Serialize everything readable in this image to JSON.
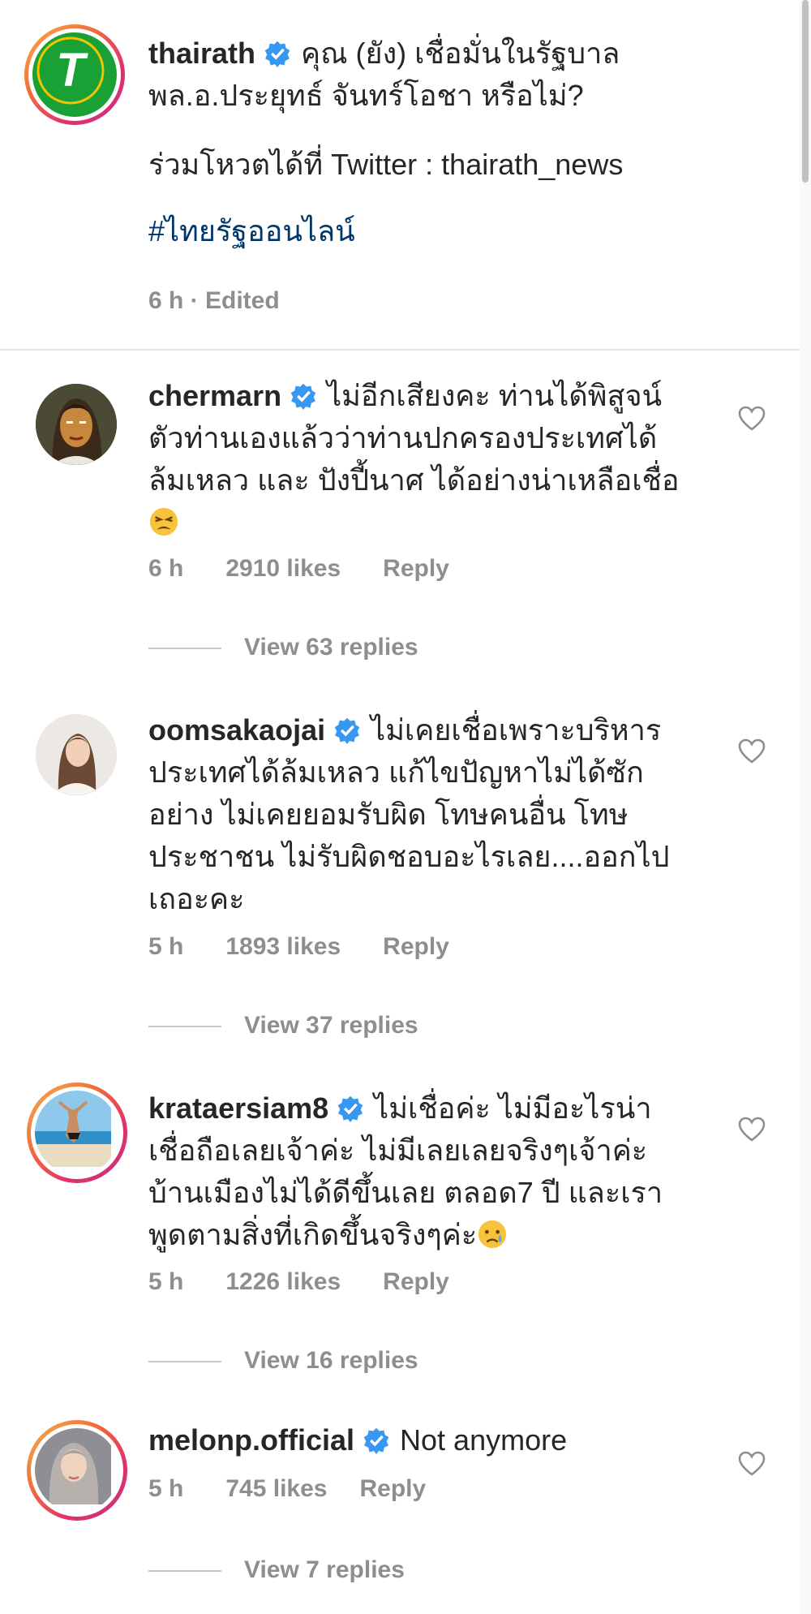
{
  "post": {
    "username": "thairath",
    "caption_lines": [
      "คุณ (ยัง) เชื่อมั่นในรัฐบาล",
      "พล.อ.ประยุทธ์ จันทร์โอชา หรือไม่?",
      "ร่วมโหวตได้ที่ Twitter : thairath_news"
    ],
    "hashtag": "#ไทยรัฐออนไลน์",
    "meta": "6 h · Edited",
    "logo_letter": "T",
    "brand_color": "#1aa135"
  },
  "comments": [
    {
      "username": "chermarn",
      "lines": [
        "ไม่อีกเสียงคะ ท่านได้พิสูจน์",
        "ตัวท่านเองแล้วว่าท่านปกครองประเทศได้",
        "ล้มเหลว และ ปังปี้นาศ ได้อย่างน่าเหลือเชื่อ"
      ],
      "emoji": "tired-face-emoji",
      "time": "6 h",
      "likes": "2910 likes",
      "reply": "Reply",
      "view_replies": "View 63 replies"
    },
    {
      "username": "oomsakaojai",
      "lines": [
        "ไม่เคยเชื่อเพราะบริหาร",
        "ประเทศได้ล้มเหลว แก้ไขปัญหาไม่ได้ซัก",
        "อย่าง ไม่เคยยอมรับผิด โทษคนอื่น โทษ",
        "ประชาชน ไม่รับผิดชอบอะไรเลย....ออกไป",
        "เถอะคะ"
      ],
      "time": "5 h",
      "likes": "1893 likes",
      "reply": "Reply",
      "view_replies": "View 37 replies"
    },
    {
      "username": "krataersiam8",
      "lines": [
        "ไม่เชื่อค่ะ  ไม่มีอะไรน่า",
        "เชื่อถือเลยเจ้าค่ะ  ไม่มีเลยเลยจริงๆเจ้าค่ะ",
        "บ้านเมืองไม่ได้ดีขึ้นเลย ตลอด7 ปี และเรา",
        "พูดตามสิ่งที่เกิดขึ้นจริงๆค่ะ"
      ],
      "emoji": "crying-face-emoji",
      "time": "5 h",
      "likes": "1226 likes",
      "reply": "Reply",
      "view_replies": "View 16 replies"
    },
    {
      "username": "melonp.official",
      "lines": [
        "Not anymore"
      ],
      "time": "5 h",
      "likes": "745 likes",
      "reply": "Reply",
      "view_replies": "View 7 replies"
    }
  ],
  "colors": {
    "verified": "#3897f0",
    "muted": "#8e8e8e",
    "link": "#00376b"
  }
}
